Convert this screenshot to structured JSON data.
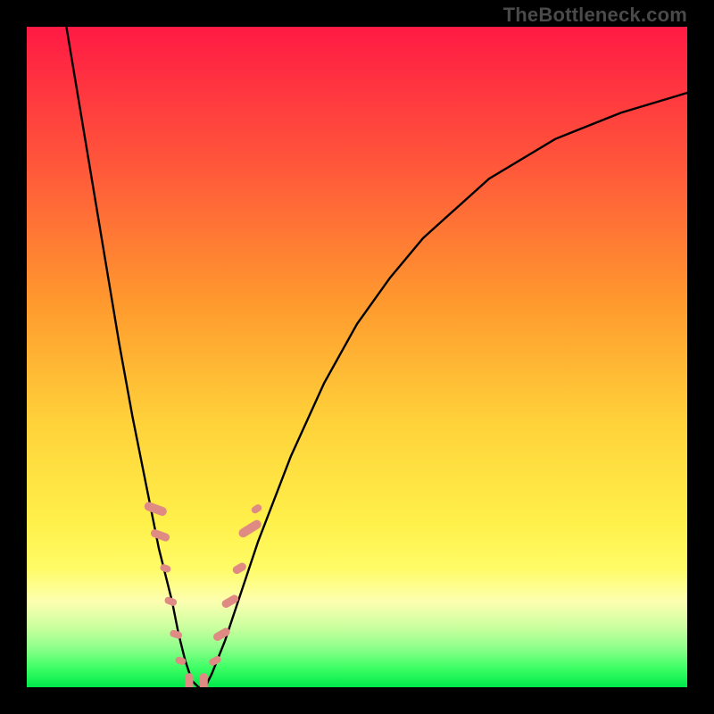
{
  "attribution": "TheBottleneck.com",
  "chart_data": {
    "type": "line",
    "title": "",
    "xlabel": "",
    "ylabel": "",
    "xlim": [
      0,
      100
    ],
    "ylim": [
      0,
      100
    ],
    "grid": false,
    "legend": false,
    "series": [
      {
        "name": "bottleneck-curve",
        "x": [
          6,
          8,
          10,
          12,
          14,
          16,
          18,
          20,
          21,
          22,
          23,
          24,
          25,
          26,
          27,
          28,
          30,
          32,
          35,
          40,
          45,
          50,
          55,
          60,
          70,
          80,
          90,
          100
        ],
        "y": [
          100,
          88,
          76,
          64,
          52,
          41,
          31,
          21,
          17,
          13,
          8,
          4,
          1,
          0,
          0,
          2,
          7,
          13,
          22,
          35,
          46,
          55,
          62,
          68,
          77,
          83,
          87,
          90
        ]
      }
    ],
    "markers": [
      {
        "name": "left-cluster",
        "approx_x": 20,
        "approx_y_range": [
          12,
          28
        ],
        "color": "#e08a84"
      },
      {
        "name": "bottom-cluster",
        "approx_x": 25,
        "approx_y_range": [
          0,
          3
        ],
        "color": "#e08a84"
      },
      {
        "name": "right-cluster",
        "approx_x": 32,
        "approx_y_range": [
          10,
          28
        ],
        "color": "#e08a84"
      }
    ],
    "gradient_stops": [
      {
        "pos": 0.0,
        "color": "#ff1a44"
      },
      {
        "pos": 0.22,
        "color": "#ff5a3a"
      },
      {
        "pos": 0.42,
        "color": "#ff9a2e"
      },
      {
        "pos": 0.6,
        "color": "#ffd23a"
      },
      {
        "pos": 0.75,
        "color": "#fff04a"
      },
      {
        "pos": 0.82,
        "color": "#fffc66"
      },
      {
        "pos": 0.87,
        "color": "#fdffb0"
      },
      {
        "pos": 0.91,
        "color": "#c9ff9e"
      },
      {
        "pos": 0.94,
        "color": "#8fff8c"
      },
      {
        "pos": 0.97,
        "color": "#3fff66"
      },
      {
        "pos": 1.0,
        "color": "#00e84a"
      }
    ],
    "marker_color": "#e08a84",
    "line_color": "#000000"
  }
}
